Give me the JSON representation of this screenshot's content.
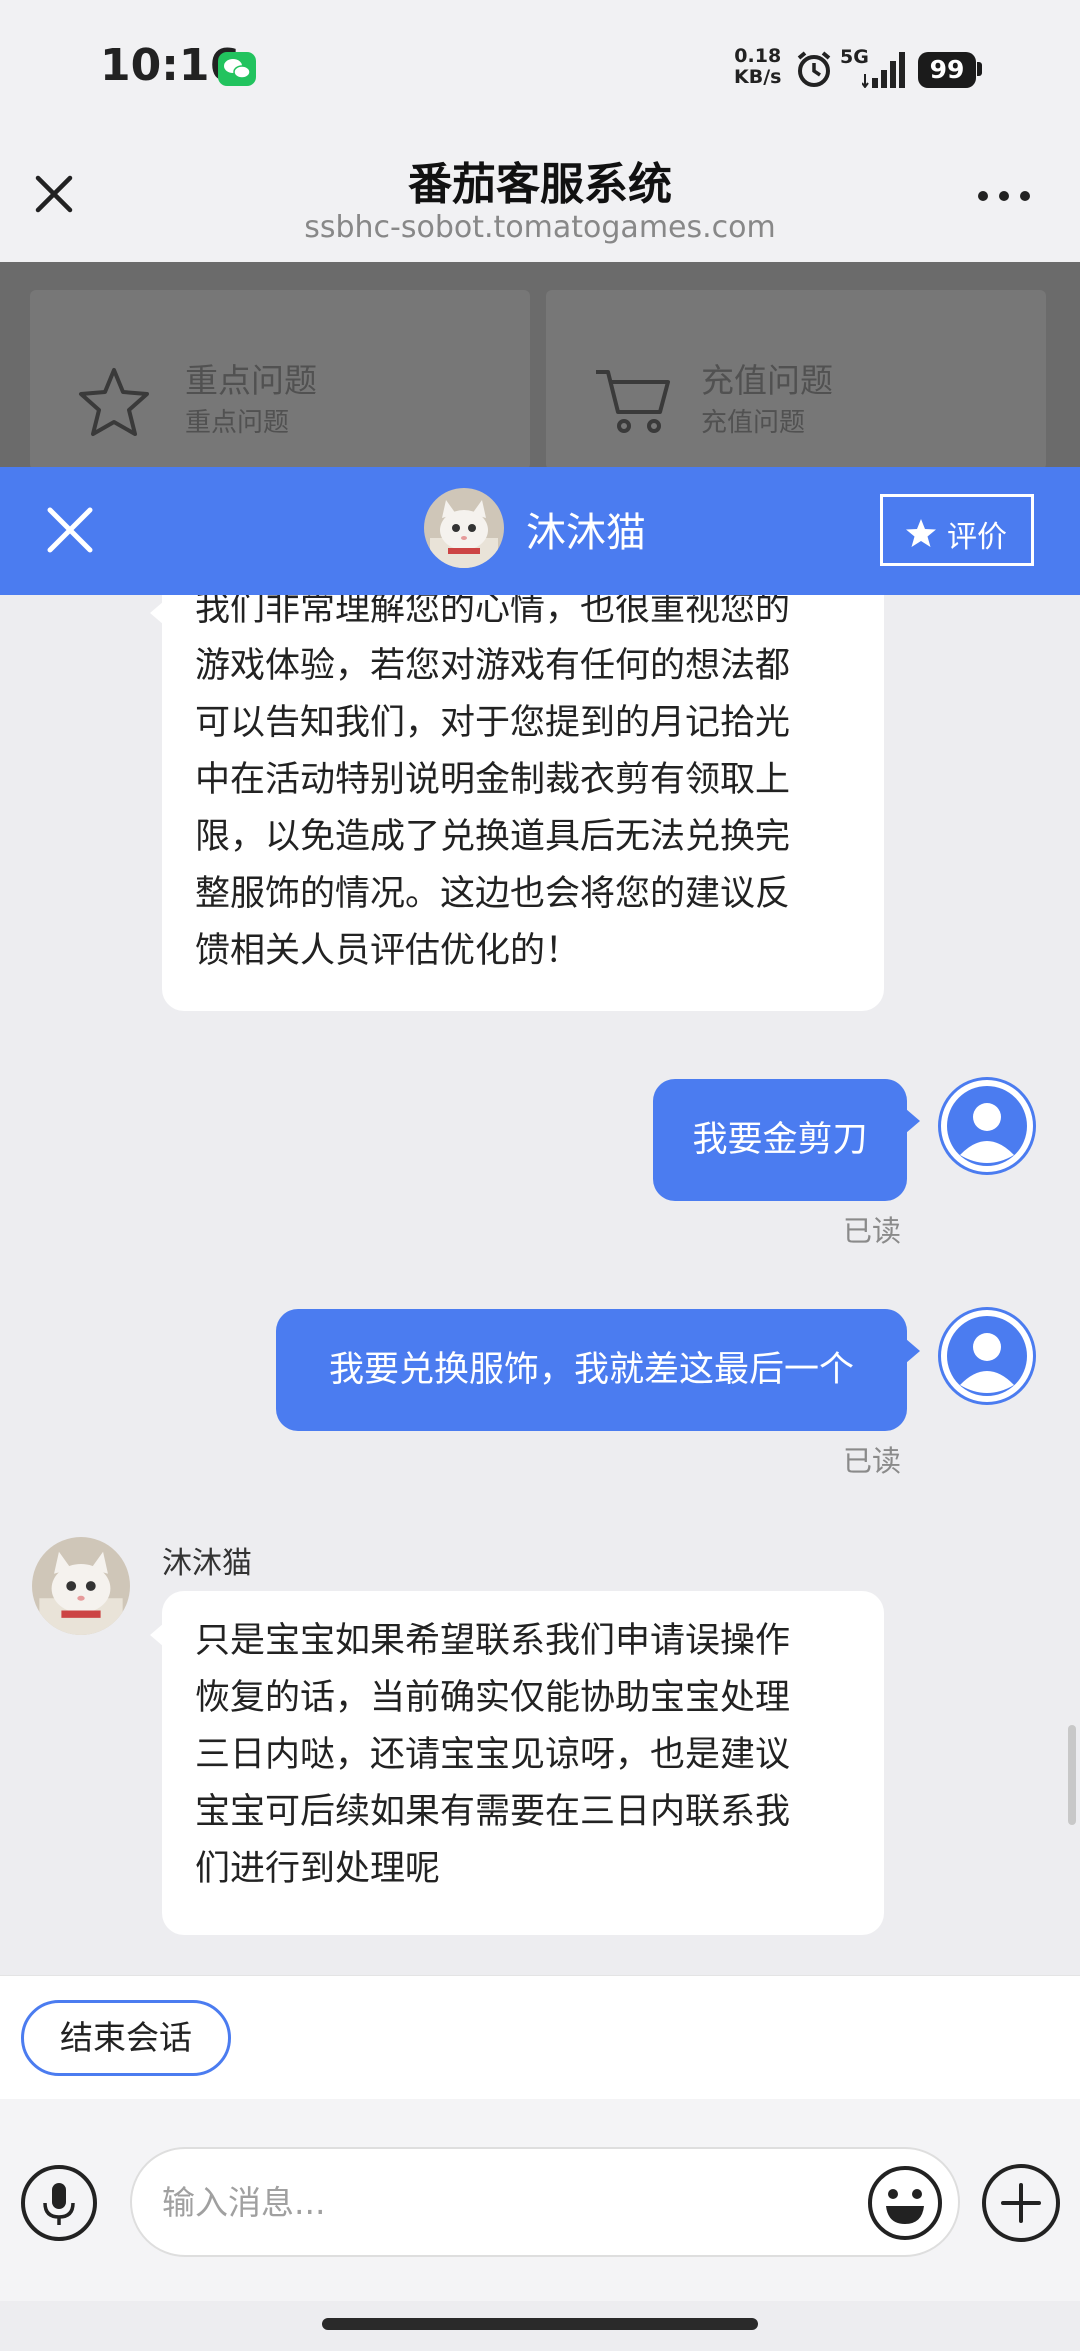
{
  "status_bar": {
    "time": "10:16",
    "net_speed_value": "0.18",
    "net_speed_unit": "KB/s",
    "network": "5G",
    "battery": "99"
  },
  "browser": {
    "title": "番茄客服系统",
    "url": "ssbhc-sobot.tomatogames.com"
  },
  "quick_tiles": [
    {
      "label": "重点问题",
      "sub": "重点问题",
      "icon": "star-icon"
    },
    {
      "label": "充值问题",
      "sub": "充值问题",
      "icon": "cart-icon"
    }
  ],
  "chat_header": {
    "agent_name": "沐沐猫",
    "rate_label": "评价"
  },
  "messages": {
    "agent_1_lines": [
      "我们非常理解您的心情，也很重视您的",
      "游戏体验，若您对游戏有任何的想法都",
      "可以告知我们，对于您提到的月记拾光",
      "中在活动特别说明金制裁衣剪有领取上",
      "限，以免造成了兑换道具后无法兑换完",
      "整服饰的情况。这边也会将您的建议反",
      "馈相关人员评估优化的！"
    ],
    "user_1": "我要金剪刀",
    "user_1_status": "已读",
    "user_2": "我要兑换服饰，我就差这最后一个",
    "user_2_status": "已读",
    "agent_2_sender": "沐沐猫",
    "agent_2_lines": [
      "只是宝宝如果希望联系我们申请误操作",
      "恢复的话，当前确实仅能协助宝宝处理",
      "三日内哒，还请宝宝见谅呀，也是建议",
      "宝宝可后续如果有需要在三日内联系我",
      "们进行到处理呢"
    ]
  },
  "end_session_label": "结束会话",
  "input": {
    "placeholder": "输入消息..."
  },
  "colors": {
    "accent": "#4b7cf0",
    "background": "#ededf0"
  }
}
